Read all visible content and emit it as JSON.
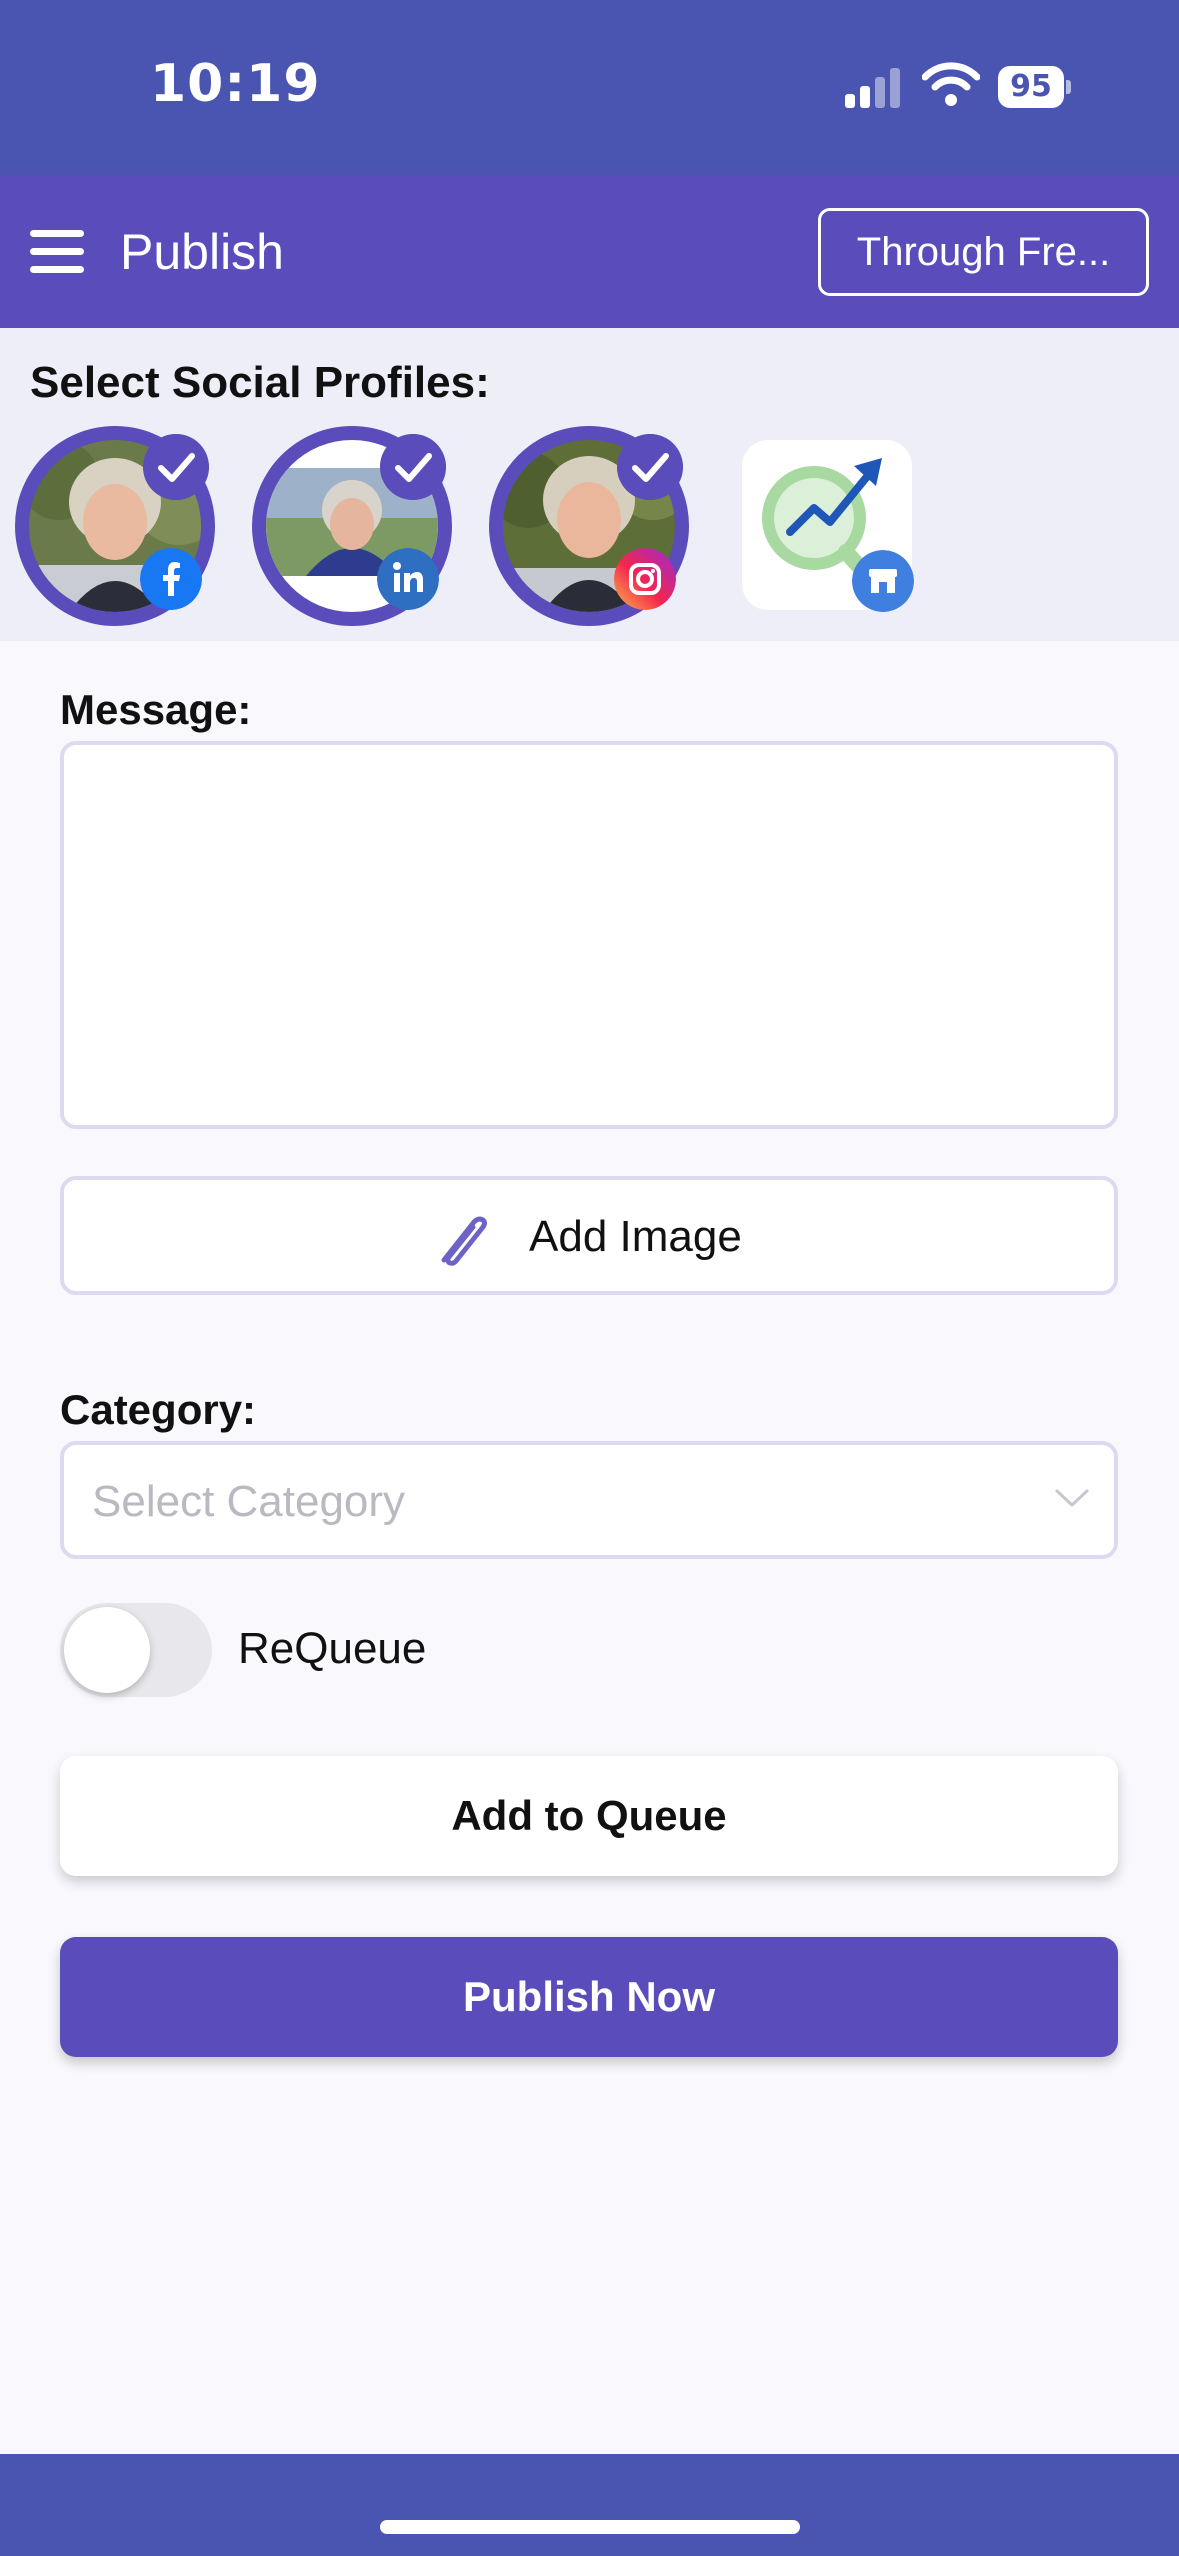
{
  "status_bar": {
    "time": "10:19",
    "battery": "95"
  },
  "header": {
    "title": "Publish",
    "account_button": "Through Fre..."
  },
  "profiles": {
    "label": "Select Social Profiles:",
    "items": [
      {
        "network": "facebook",
        "selected": true
      },
      {
        "network": "linkedin",
        "selected": true
      },
      {
        "network": "instagram",
        "selected": true
      },
      {
        "network": "google-business",
        "selected": false
      }
    ]
  },
  "form": {
    "message_label": "Message:",
    "message_value": "",
    "add_image_label": "Add Image",
    "category_label": "Category:",
    "category_placeholder": "Select Category",
    "requeue_label": "ReQueue",
    "requeue_on": false,
    "add_to_queue_label": "Add to Queue",
    "publish_now_label": "Publish Now"
  },
  "colors": {
    "primary": "#5A4DBB",
    "status_bar": "#4A55B1",
    "facebook": "#1877F2",
    "linkedin": "#2E6FC2"
  }
}
